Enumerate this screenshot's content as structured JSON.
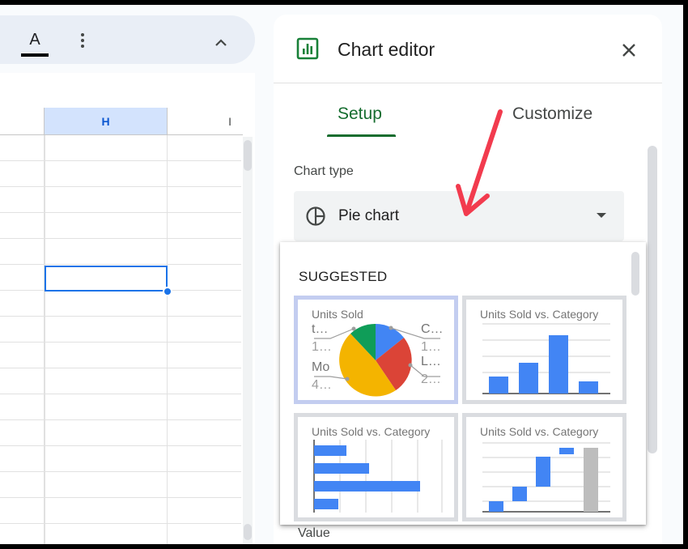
{
  "toolbar": {
    "text_color_glyph": "A",
    "text_color_icon": "text-color-icon",
    "more_icon": "more-vert-icon",
    "collapse_icon": "chevron-up-icon"
  },
  "sheet": {
    "columns": [
      "H",
      "I"
    ],
    "selected_color": "#1a73e8"
  },
  "chart_editor": {
    "title": "Chart editor",
    "title_icon": "chart-icon",
    "close_icon": "close-icon",
    "tabs": [
      {
        "label": "Setup",
        "active": true
      },
      {
        "label": "Customize",
        "active": false
      }
    ],
    "chart_type_label": "Chart type",
    "chart_type_value": "Pie chart",
    "chart_type_icon": "pie-chart-icon",
    "below_label": "Value",
    "accent_color": "#146c2e"
  },
  "dropdown": {
    "heading": "SUGGESTED",
    "thumbnails": [
      {
        "title": "Units Sold",
        "type": "pie",
        "selected": true,
        "labels": [
          {
            "text": "t…",
            "sub": "1…"
          },
          {
            "text": "Mo",
            "sub": "4…"
          },
          {
            "text": "C…",
            "sub": "1…"
          },
          {
            "text": "L…",
            "sub": "2…"
          }
        ]
      },
      {
        "title": "Units Sold vs. Category",
        "type": "column",
        "selected": false
      },
      {
        "title": "Units Sold vs. Category",
        "type": "bar",
        "selected": false
      },
      {
        "title": "Units Sold vs. Category",
        "type": "waterfall",
        "selected": false
      }
    ]
  },
  "annotation": {
    "color": "#f23b4e",
    "icon": "red-arrow-annotation"
  }
}
